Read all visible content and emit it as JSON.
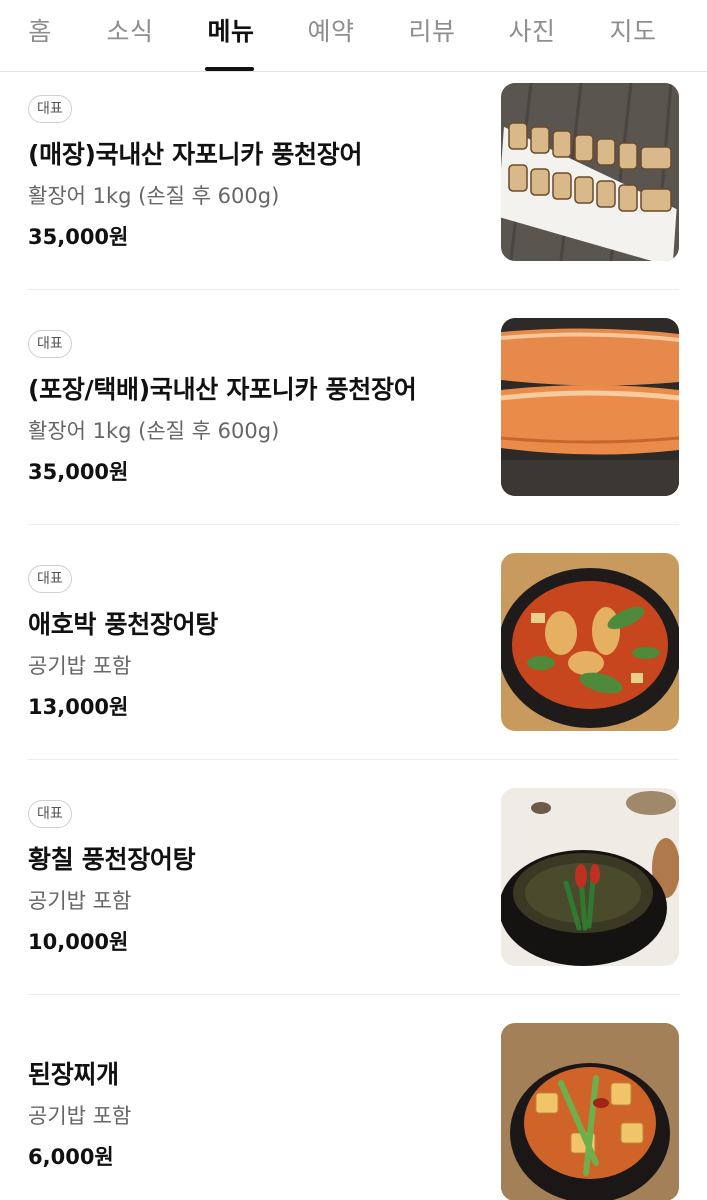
{
  "tabs": [
    {
      "label": "홈",
      "active": false
    },
    {
      "label": "소식",
      "active": false
    },
    {
      "label": "메뉴",
      "active": true
    },
    {
      "label": "예약",
      "active": false
    },
    {
      "label": "리뷰",
      "active": false
    },
    {
      "label": "사진",
      "active": false
    },
    {
      "label": "지도",
      "active": false
    }
  ],
  "menu": {
    "items": [
      {
        "badge": "대표",
        "name": "(매장)국내산 자포니카 풍천장어",
        "description": "활장어 1kg (손질 후 600g)",
        "price": "35,000원",
        "image": "grilled-eel-platter"
      },
      {
        "badge": "대표",
        "name": "(포장/택배)국내산 자포니카 풍천장어",
        "description": "활장어 1kg (손질 후 600g)",
        "price": "35,000원",
        "image": "seasoned-eel-fillets"
      },
      {
        "badge": "대표",
        "name": "애호박 풍천장어탕",
        "description": "공기밥 포함",
        "price": "13,000원",
        "image": "zucchini-eel-soup"
      },
      {
        "badge": "대표",
        "name": "황칠 풍천장어탕",
        "description": "공기밥 포함",
        "price": "10,000원",
        "image": "hwangchil-eel-soup"
      },
      {
        "badge": "",
        "name": "된장찌개",
        "description": "공기밥 포함",
        "price": "6,000원",
        "image": "doenjang-stew"
      }
    ]
  }
}
